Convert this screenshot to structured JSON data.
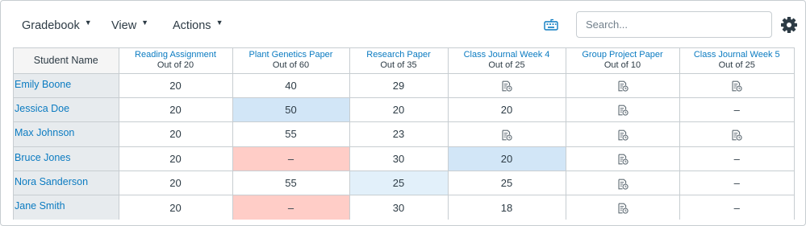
{
  "toolbar": {
    "gradebook_label": "Gradebook",
    "view_label": "View",
    "actions_label": "Actions",
    "caret": "▼",
    "keyboard_icon": "keyboard-icon",
    "settings_icon": "gear-icon"
  },
  "search": {
    "placeholder": "Search..."
  },
  "colors": {
    "link": "#0b7bc1",
    "student_col_bg": "#e7ebee",
    "highlight_blue": "#d2e6f7",
    "highlight_light_blue": "#e2f0fa",
    "highlight_red": "#ffcdc7",
    "border": "#c7cdd1"
  },
  "grid": {
    "student_header": "Student Name",
    "assignments": [
      {
        "name": "Reading Assignment",
        "out_of": "Out of 20"
      },
      {
        "name": "Plant Genetics Paper",
        "out_of": "Out of 60"
      },
      {
        "name": "Research Paper",
        "out_of": "Out of 35"
      },
      {
        "name": "Class Journal Week 4",
        "out_of": "Out of 25"
      },
      {
        "name": "Group Project Paper",
        "out_of": "Out of 10"
      },
      {
        "name": "Class Journal Week 5",
        "out_of": "Out of 25"
      }
    ],
    "rows": [
      {
        "student": "Emily Boone",
        "cells": [
          {
            "value": "20"
          },
          {
            "value": "40"
          },
          {
            "value": "29"
          },
          {
            "icon": "submission-icon"
          },
          {
            "icon": "submission-icon"
          },
          {
            "icon": "submission-icon"
          }
        ]
      },
      {
        "student": "Jessica Doe",
        "cells": [
          {
            "value": "20"
          },
          {
            "value": "50",
            "status": "blue"
          },
          {
            "value": "20"
          },
          {
            "value": "20"
          },
          {
            "icon": "submission-icon"
          },
          {
            "value": "–"
          }
        ]
      },
      {
        "student": "Max Johnson",
        "cells": [
          {
            "value": "20"
          },
          {
            "value": "55"
          },
          {
            "value": "23"
          },
          {
            "icon": "submission-icon"
          },
          {
            "icon": "submission-icon"
          },
          {
            "icon": "submission-icon"
          }
        ]
      },
      {
        "student": "Bruce Jones",
        "cells": [
          {
            "value": "20"
          },
          {
            "value": "–",
            "status": "red"
          },
          {
            "value": "30"
          },
          {
            "value": "20",
            "status": "blue"
          },
          {
            "icon": "submission-icon"
          },
          {
            "value": "–"
          }
        ]
      },
      {
        "student": "Nora Sanderson",
        "cells": [
          {
            "value": "20"
          },
          {
            "value": "55"
          },
          {
            "value": "25",
            "status": "lightblue"
          },
          {
            "value": "25"
          },
          {
            "icon": "submission-icon"
          },
          {
            "value": "–"
          }
        ]
      },
      {
        "student": "Jane Smith",
        "cells": [
          {
            "value": "20"
          },
          {
            "value": "–",
            "status": "red"
          },
          {
            "value": "30"
          },
          {
            "value": "18"
          },
          {
            "icon": "submission-icon"
          },
          {
            "value": "–"
          }
        ]
      }
    ]
  }
}
